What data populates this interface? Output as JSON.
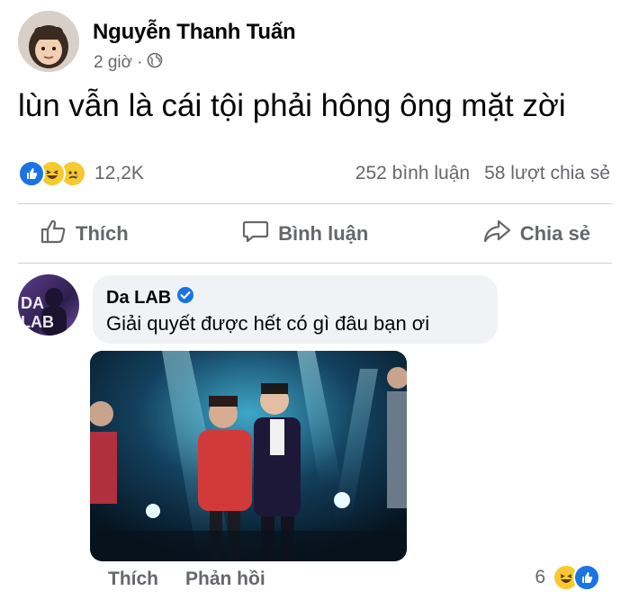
{
  "post": {
    "author": "Nguyễn Thanh Tuấn",
    "time": "2 giờ",
    "separator": "·",
    "privacy_icon": "globe-icon",
    "text": "lùn vẫn là cái tội phải hông ông mặt zời"
  },
  "reactions": {
    "icons": [
      "like-icon",
      "haha-icon",
      "sad-icon"
    ],
    "count": "12,2K",
    "comments": "252 bình luận",
    "shares": "58 lượt chia sẻ"
  },
  "actions": {
    "like": "Thích",
    "comment": "Bình luận",
    "share": "Chia sẻ"
  },
  "comment": {
    "author": "Da LAB",
    "verified_icon": "verified-badge-icon",
    "avatar_text": "DA LAB",
    "text": "Giải quyết được hết có gì đâu bạn ơi",
    "like_label": "Thích",
    "reply_label": "Phản hồi",
    "reaction_count": "6",
    "reaction_icons": [
      "haha-icon",
      "like-icon"
    ]
  },
  "colors": {
    "facebook_blue": "#1b74e4",
    "secondary_text": "#65676b",
    "bubble_bg": "#f0f2f5",
    "divider": "#ced0d4"
  }
}
